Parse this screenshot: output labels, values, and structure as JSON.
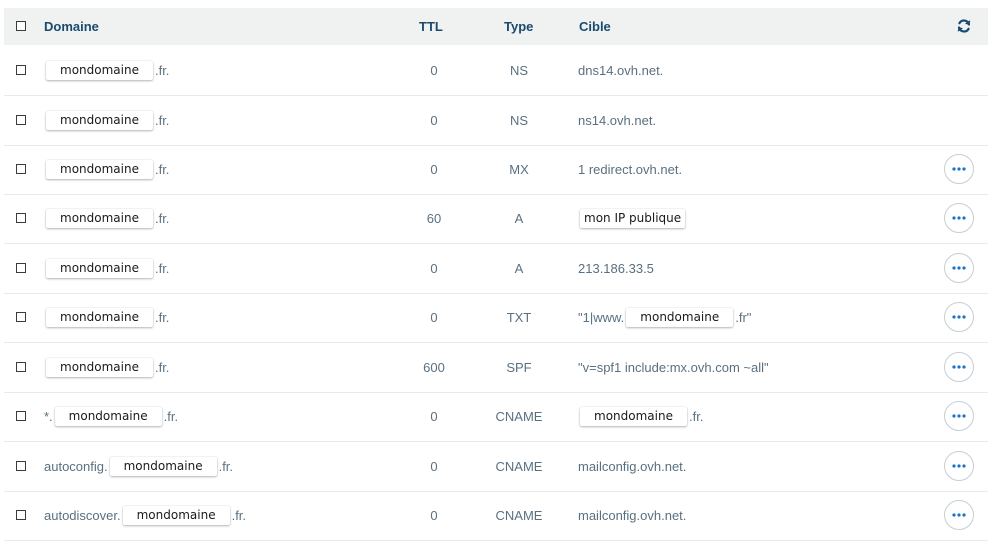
{
  "header": {
    "domain": "Domaine",
    "ttl": "TTL",
    "type": "Type",
    "target": "Cible"
  },
  "rows": [
    {
      "prefix": "",
      "sub": "mondomaine",
      "suffix": ".fr.",
      "ttl": "0",
      "type": "NS",
      "target_pre": "dns14.ovh.net.",
      "target_pill": "",
      "target_post": "",
      "has_more": false
    },
    {
      "prefix": "",
      "sub": "mondomaine",
      "suffix": ".fr.",
      "ttl": "0",
      "type": "NS",
      "target_pre": "ns14.ovh.net.",
      "target_pill": "",
      "target_post": "",
      "has_more": false
    },
    {
      "prefix": "",
      "sub": "mondomaine",
      "suffix": ".fr.",
      "ttl": "0",
      "type": "MX",
      "target_pre": "1 redirect.ovh.net.",
      "target_pill": "",
      "target_post": "",
      "has_more": true
    },
    {
      "prefix": "",
      "sub": "mondomaine",
      "suffix": ".fr.",
      "ttl": "60",
      "type": "A",
      "target_pre": "",
      "target_pill": "mon IP publique",
      "target_post": "",
      "has_more": true
    },
    {
      "prefix": "",
      "sub": "mondomaine",
      "suffix": ".fr.",
      "ttl": "0",
      "type": "A",
      "target_pre": "213.186.33.5",
      "target_pill": "",
      "target_post": "",
      "has_more": true
    },
    {
      "prefix": "",
      "sub": "mondomaine",
      "suffix": ".fr.",
      "ttl": "0",
      "type": "TXT",
      "target_pre": "\"1|www.",
      "target_pill": "mondomaine",
      "target_post": ".fr\"",
      "has_more": true
    },
    {
      "prefix": "",
      "sub": "mondomaine",
      "suffix": ".fr.",
      "ttl": "600",
      "type": "SPF",
      "target_pre": "\"v=spf1 include:mx.ovh.com ~all\"",
      "target_pill": "",
      "target_post": "",
      "has_more": true
    },
    {
      "prefix": "*.",
      "sub": "mondomaine",
      "suffix": ".fr.",
      "ttl": "0",
      "type": "CNAME",
      "target_pre": "",
      "target_pill": "mondomaine",
      "target_post": ".fr.",
      "has_more": true
    },
    {
      "prefix": "autoconfig.",
      "sub": "mondomaine",
      "suffix": ".fr.",
      "ttl": "0",
      "type": "CNAME",
      "target_pre": "mailconfig.ovh.net.",
      "target_pill": "",
      "target_post": "",
      "has_more": true
    },
    {
      "prefix": "autodiscover.",
      "sub": "mondomaine",
      "suffix": ".fr.",
      "ttl": "0",
      "type": "CNAME",
      "target_pre": "mailconfig.ovh.net.",
      "target_pill": "",
      "target_post": "",
      "has_more": true
    }
  ],
  "icons": {
    "row_menu": "more-options-icon",
    "refresh": "refresh-icon"
  },
  "colors": {
    "header_bg": "#f0f2f2",
    "header_text": "#1a4a6e",
    "accent": "#1a73c8"
  }
}
